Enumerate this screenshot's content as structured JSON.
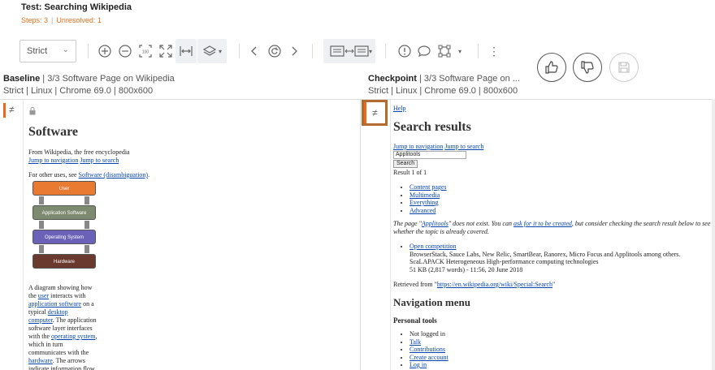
{
  "header": {
    "title": "Test:  Searching Wikipedia",
    "steps": "Steps: 3",
    "unresolved": "Unresolved: 1"
  },
  "toolbar": {
    "match_level": "Strict",
    "icons": [
      "zoom-in-icon",
      "zoom-out-icon",
      "actual-size-icon",
      "fit-icon",
      "fit-width-icon",
      "layers-icon",
      "prev-icon",
      "refresh-icon",
      "next-icon",
      "side-by-side-icon",
      "issue-icon",
      "comment-icon",
      "region-icon",
      "more-icon"
    ]
  },
  "actions": {
    "accept": "thumbs-up-icon",
    "reject": "thumbs-down-icon",
    "save": "save-icon"
  },
  "baseline": {
    "label": "Baseline",
    "title": "3/3 Software Page on Wikipedia",
    "meta": "Strict | Linux | Chrome 69.0 | 800x600",
    "page": {
      "heading": "Software",
      "from": "From Wikipedia, the free encyclopedia",
      "jump_nav": "Jump to navigation",
      "jump_search": "Jump to search",
      "other_prefix": "For other uses, see ",
      "other_link": "Software (disambiguation)",
      "diagram": [
        "User",
        "Application Software",
        "Operating System",
        "Hardware"
      ],
      "desc": [
        {
          "t": "A diagram showing how"
        },
        {
          "t": "the "
        },
        {
          "l": "user"
        },
        {
          "t": " interacts with"
        },
        {
          "l": "application software"
        },
        {
          "t": " on a"
        },
        {
          "t": "typical "
        },
        {
          "l": "desktop"
        },
        {
          "l": "computer"
        },
        {
          "t": ". The application"
        },
        {
          "t": "software layer interfaces"
        },
        {
          "t": "with the "
        },
        {
          "l": "operating system"
        },
        {
          "t": ","
        },
        {
          "t": "which in turn"
        },
        {
          "t": "communicates with the"
        },
        {
          "l": "hardware"
        },
        {
          "t": ". The arrows"
        },
        {
          "t": "indicate information flow."
        }
      ]
    }
  },
  "checkpoint": {
    "label": "Checkpoint",
    "title": "3/3 Software Page on ...",
    "meta": "Strict | Linux | Chrome 69.0 | 800x600",
    "page": {
      "help": "Help",
      "heading": "Search results",
      "jump_nav": "Jump to navigation",
      "jump_search": "Jump to search",
      "search_value": "Applitools",
      "search_button": "Search",
      "result_count": "Result 1 of 1",
      "filters": [
        "Content pages",
        "Multimedia",
        "Everything",
        "Advanced"
      ],
      "notice_a": "The page \"",
      "notice_link": "Applitools",
      "notice_b": "\" does not exist. You can ",
      "notice_ask": "ask for it to be created",
      "notice_c": ", but consider checking the search result below to see whether the topic is already covered.",
      "result_title": "Open competition",
      "result_line1": "BrowserStack, Sauce Labs, New Relic, SmartBear, Ranorex, Micro Focus and Applitools among others.",
      "result_line2": "ScaLAPACK Heterogeneous High-performance computing technologies",
      "result_line3": "51 KB (2,817 words) - 11:56, 20 June 2018",
      "retrieved_prefix": "Retrieved from \"",
      "retrieved_link": "https://en.wikipedia.org/wiki/Special:Search",
      "retrieved_suffix": "\"",
      "nav_heading": "Navigation menu",
      "personal_heading": "Personal tools",
      "personal": [
        "Not logged in",
        "Talk",
        "Contributions",
        "Create account",
        "Log in"
      ]
    }
  },
  "colors": {
    "accent": "#e86a1a",
    "link": "#0645ad"
  }
}
